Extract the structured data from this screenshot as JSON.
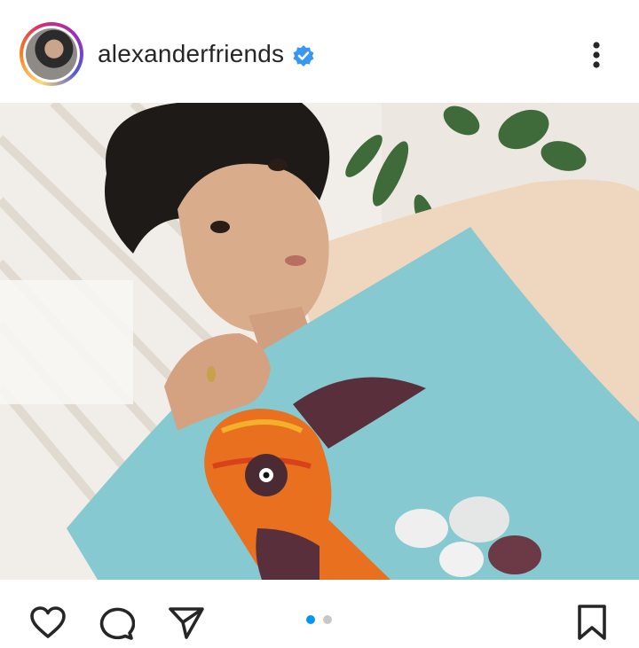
{
  "post": {
    "username": "alexanderfriends",
    "verified": true,
    "photo_description_icon": "photo-image"
  },
  "icons": {
    "verified": "verified-badge-icon",
    "more": "more-options-icon",
    "like": "heart-icon",
    "comment": "comment-icon",
    "share": "send-icon",
    "save": "bookmark-icon"
  },
  "carousel": {
    "total_slides": 2,
    "active_slide": 1
  },
  "colors": {
    "verified": "#3897f0",
    "active_dot": "#0095f6",
    "inactive_dot": "#c7c7c7",
    "text": "#262626"
  }
}
